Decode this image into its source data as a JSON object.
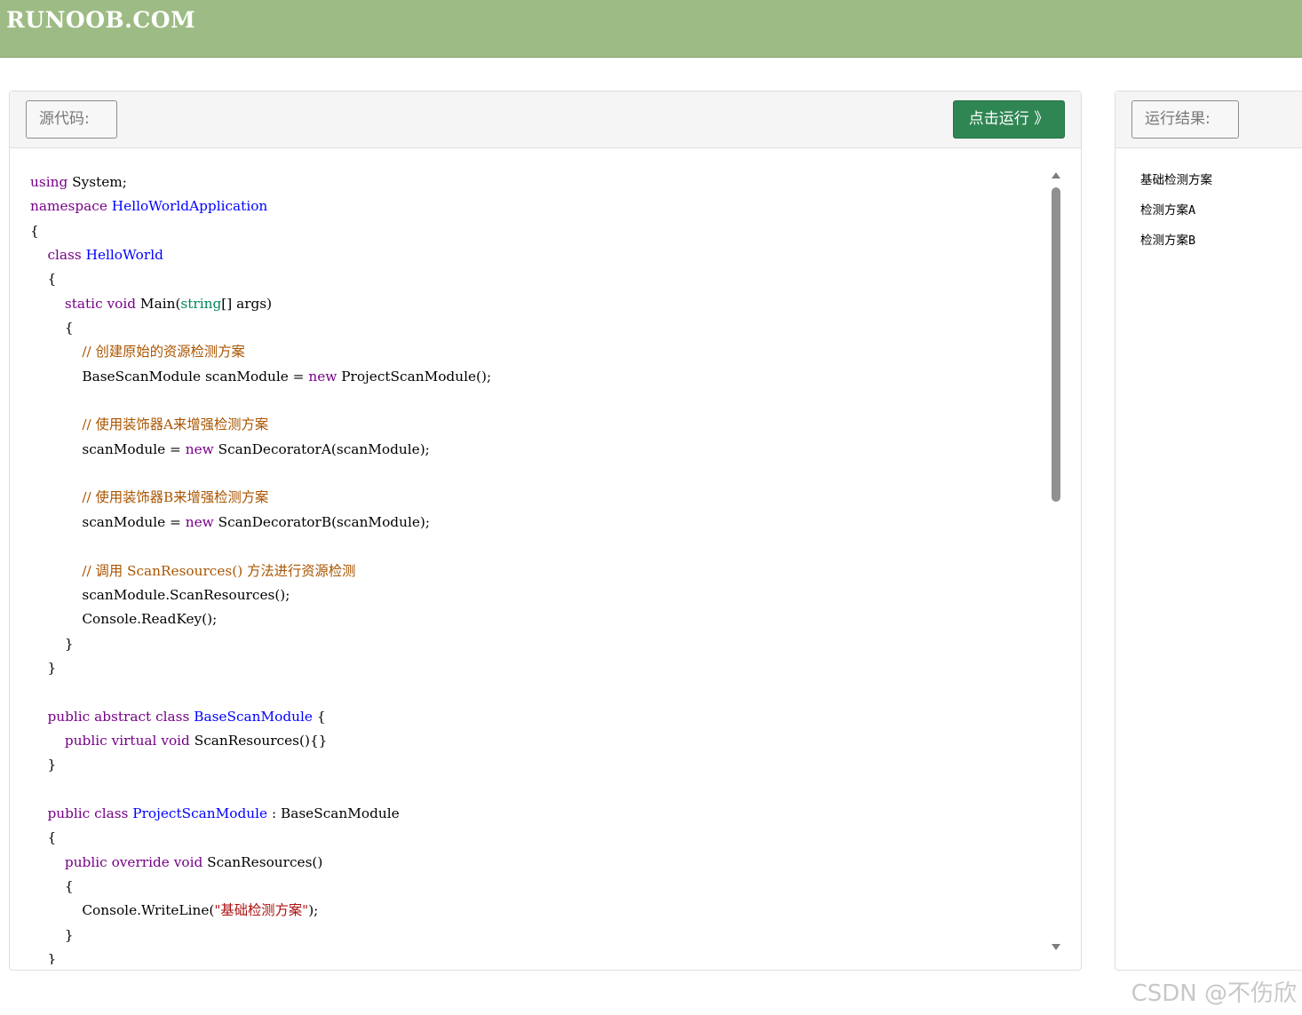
{
  "header": {
    "logo_text": "RUNOOB.COM"
  },
  "source_panel": {
    "label": "源代码:",
    "run_button": "点击运行 》",
    "code_lines": [
      [
        {
          "t": "kw",
          "v": "using"
        },
        {
          "t": "",
          "v": " System;"
        }
      ],
      [
        {
          "t": "kw",
          "v": "namespace"
        },
        {
          "t": "",
          "v": " "
        },
        {
          "t": "def",
          "v": "HelloWorldApplication"
        }
      ],
      [
        {
          "t": "",
          "v": "{"
        }
      ],
      [
        {
          "t": "",
          "v": "    "
        },
        {
          "t": "kw",
          "v": "class"
        },
        {
          "t": "",
          "v": " "
        },
        {
          "t": "def",
          "v": "HelloWorld"
        }
      ],
      [
        {
          "t": "",
          "v": "    {"
        }
      ],
      [
        {
          "t": "",
          "v": "        "
        },
        {
          "t": "kw",
          "v": "static"
        },
        {
          "t": "",
          "v": " "
        },
        {
          "t": "kw",
          "v": "void"
        },
        {
          "t": "",
          "v": " Main("
        },
        {
          "t": "ty",
          "v": "string"
        },
        {
          "t": "",
          "v": "[] args)"
        }
      ],
      [
        {
          "t": "",
          "v": "        {"
        }
      ],
      [
        {
          "t": "",
          "v": "            "
        },
        {
          "t": "cm",
          "v": "// 创建原始的资源检测方案"
        }
      ],
      [
        {
          "t": "",
          "v": "            BaseScanModule scanModule = "
        },
        {
          "t": "kw",
          "v": "new"
        },
        {
          "t": "",
          "v": " ProjectScanModule();"
        }
      ],
      [
        {
          "t": "",
          "v": ""
        }
      ],
      [
        {
          "t": "",
          "v": "            "
        },
        {
          "t": "cm",
          "v": "// 使用装饰器A来增强检测方案"
        }
      ],
      [
        {
          "t": "",
          "v": "            scanModule = "
        },
        {
          "t": "kw",
          "v": "new"
        },
        {
          "t": "",
          "v": " ScanDecoratorA(scanModule);"
        }
      ],
      [
        {
          "t": "",
          "v": ""
        }
      ],
      [
        {
          "t": "",
          "v": "            "
        },
        {
          "t": "cm",
          "v": "// 使用装饰器B来增强检测方案"
        }
      ],
      [
        {
          "t": "",
          "v": "            scanModule = "
        },
        {
          "t": "kw",
          "v": "new"
        },
        {
          "t": "",
          "v": " ScanDecoratorB(scanModule);"
        }
      ],
      [
        {
          "t": "",
          "v": ""
        }
      ],
      [
        {
          "t": "",
          "v": "            "
        },
        {
          "t": "cm",
          "v": "// 调用 ScanResources() 方法进行资源检测"
        }
      ],
      [
        {
          "t": "",
          "v": "            scanModule.ScanResources();"
        }
      ],
      [
        {
          "t": "",
          "v": "            Console.ReadKey();"
        }
      ],
      [
        {
          "t": "",
          "v": "        }"
        }
      ],
      [
        {
          "t": "",
          "v": "    }"
        }
      ],
      [
        {
          "t": "",
          "v": ""
        }
      ],
      [
        {
          "t": "",
          "v": "    "
        },
        {
          "t": "kw",
          "v": "public"
        },
        {
          "t": "",
          "v": " "
        },
        {
          "t": "kw",
          "v": "abstract"
        },
        {
          "t": "",
          "v": " "
        },
        {
          "t": "kw",
          "v": "class"
        },
        {
          "t": "",
          "v": " "
        },
        {
          "t": "def",
          "v": "BaseScanModule"
        },
        {
          "t": "",
          "v": " {"
        }
      ],
      [
        {
          "t": "",
          "v": "        "
        },
        {
          "t": "kw",
          "v": "public"
        },
        {
          "t": "",
          "v": " "
        },
        {
          "t": "kw",
          "v": "virtual"
        },
        {
          "t": "",
          "v": " "
        },
        {
          "t": "kw",
          "v": "void"
        },
        {
          "t": "",
          "v": " ScanResources(){}"
        }
      ],
      [
        {
          "t": "",
          "v": "    }"
        }
      ],
      [
        {
          "t": "",
          "v": ""
        }
      ],
      [
        {
          "t": "",
          "v": "    "
        },
        {
          "t": "kw",
          "v": "public"
        },
        {
          "t": "",
          "v": " "
        },
        {
          "t": "kw",
          "v": "class"
        },
        {
          "t": "",
          "v": " "
        },
        {
          "t": "def",
          "v": "ProjectScanModule"
        },
        {
          "t": "",
          "v": " : BaseScanModule"
        }
      ],
      [
        {
          "t": "",
          "v": "    {"
        }
      ],
      [
        {
          "t": "",
          "v": "        "
        },
        {
          "t": "kw",
          "v": "public"
        },
        {
          "t": "",
          "v": " "
        },
        {
          "t": "kw",
          "v": "override"
        },
        {
          "t": "",
          "v": " "
        },
        {
          "t": "kw",
          "v": "void"
        },
        {
          "t": "",
          "v": " ScanResources()"
        }
      ],
      [
        {
          "t": "",
          "v": "        {"
        }
      ],
      [
        {
          "t": "",
          "v": "            Console.WriteLine("
        },
        {
          "t": "st",
          "v": "\"基础检测方案\""
        },
        {
          "t": "",
          "v": ");"
        }
      ],
      [
        {
          "t": "",
          "v": "        }"
        }
      ],
      [
        {
          "t": "",
          "v": "    }"
        }
      ]
    ]
  },
  "result_panel": {
    "label": "运行结果:",
    "output_lines": [
      "基础检测方案",
      "检测方案A",
      "检测方案B"
    ]
  },
  "watermark": "CSDN @不伤欣",
  "colors": {
    "topbar": "#9dbb84",
    "run_button": "#2f8653",
    "keyword": "#770088",
    "definition": "#0000ff",
    "type": "#008855",
    "comment": "#aa5500",
    "string": "#aa1111"
  }
}
